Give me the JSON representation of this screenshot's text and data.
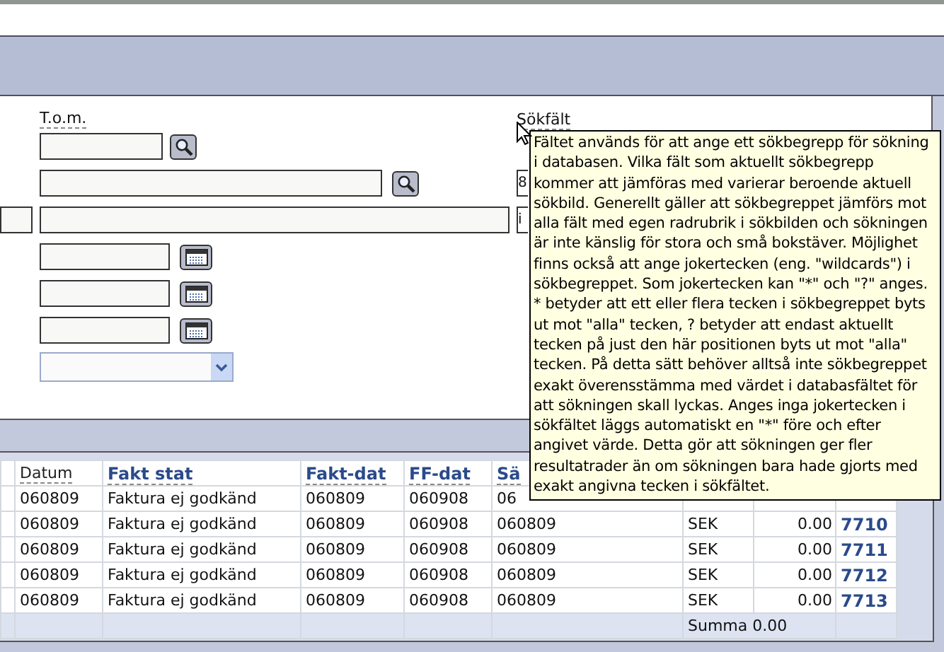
{
  "form": {
    "to_label": "T.o.m.",
    "search_label": "Sökfält",
    "rows": [
      {
        "kind": "lookup-short"
      },
      {
        "kind": "lookup-long",
        "side_value": "8"
      },
      {
        "kind": "text-wide",
        "side_value": "i"
      },
      {
        "kind": "date"
      },
      {
        "kind": "date"
      },
      {
        "kind": "date"
      },
      {
        "kind": "select"
      }
    ]
  },
  "tooltip": {
    "text": "Fältet används för att ange ett sökbegrepp för sökning i databasen. Vilka fält som aktuellt sökbegrepp kommer att jämföras med varierar beroende aktuell sökbild. Generellt gäller att sökbegreppet jämförs mot alla fält med egen radrubrik i sökbilden och sökningen är inte känslig för stora och små bokstäver. Möjlighet finns också att ange jokertecken (eng. \"wildcards\") i sökbegreppet. Som jokertecken kan \"*\" och \"?\" anges. * betyder att ett eller flera tecken i sökbegreppet byts ut mot \"alla\" tecken, ? betyder att endast aktuellt tecken på just den här positionen byts ut mot \"alla\" tecken. På detta sätt behöver alltså inte sökbegreppet exakt överensstämma med värdet i databasfältet för att sökningen skall lyckas. Anges inga jokertecken i sökfältet läggs automatiskt en \"*\" före och efter angivet värde. Detta gör att sökningen ger fler resultatrader än om sökningen bara hade gjorts med exakt angivna tecken i sökfältet."
  },
  "table": {
    "columns": [
      {
        "label": "Datum",
        "sortable": false
      },
      {
        "label": "Fakt stat",
        "sortable": true
      },
      {
        "label": "Fakt-dat",
        "sortable": true
      },
      {
        "label": "FF-dat",
        "sortable": true
      },
      {
        "label": "Sä",
        "sortable": true
      }
    ],
    "rows": [
      {
        "cells": [
          "060809",
          "Faktura ej godkänd",
          "060809",
          "060908",
          "06"
        ]
      },
      {
        "cells": [
          "060809",
          "Faktura ej godkänd",
          "060809",
          "060908",
          "060809",
          "SEK",
          "0.00",
          "7710"
        ]
      },
      {
        "cells": [
          "060809",
          "Faktura ej godkänd",
          "060809",
          "060908",
          "060809",
          "SEK",
          "0.00",
          "7711"
        ]
      },
      {
        "cells": [
          "060809",
          "Faktura ej godkänd",
          "060809",
          "060908",
          "060809",
          "SEK",
          "0.00",
          "7712"
        ]
      },
      {
        "cells": [
          "060809",
          "Faktura ej godkänd",
          "060809",
          "060908",
          "060809",
          "SEK",
          "0.00",
          "7713"
        ]
      }
    ],
    "summary": "Summa 0.00"
  }
}
